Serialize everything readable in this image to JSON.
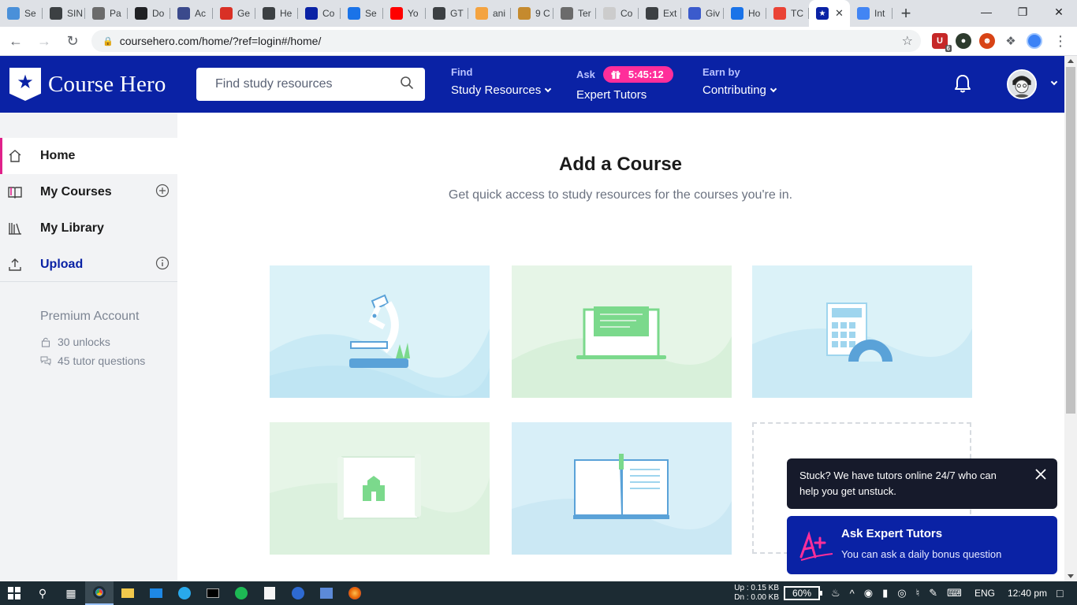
{
  "browser": {
    "tabs": [
      {
        "label": "Se",
        "color": "#4a90d9"
      },
      {
        "label": "SIN",
        "color": "#3c4043"
      },
      {
        "label": "Pa",
        "color": "#6b6b6b"
      },
      {
        "label": "Do",
        "color": "#202124"
      },
      {
        "label": "Ac",
        "color": "#3b4a8c"
      },
      {
        "label": "Ge",
        "color": "#d93025"
      },
      {
        "label": "He",
        "color": "#3c4043"
      },
      {
        "label": "Co",
        "color": "#0a22a5"
      },
      {
        "label": "Se",
        "color": "#1a73e8"
      },
      {
        "label": "Yo",
        "color": "#ff0000"
      },
      {
        "label": "GT",
        "color": "#3c4043"
      },
      {
        "label": "ani",
        "color": "#f4a340"
      },
      {
        "label": "9 C",
        "color": "#c58a2e"
      },
      {
        "label": "Ter",
        "color": "#6b6b6b"
      },
      {
        "label": "Co",
        "color": "#cccccc"
      },
      {
        "label": "Ext",
        "color": "#3c4043"
      },
      {
        "label": "Giv",
        "color": "#3b5bcc"
      },
      {
        "label": "Ho",
        "color": "#1a73e8"
      },
      {
        "label": "TC",
        "color": "#ea4335"
      },
      {
        "label": "",
        "color": "#0a22a5"
      },
      {
        "label": "Int",
        "color": "#4285f4"
      }
    ],
    "active_tab_index": 19,
    "url": "coursehero.com/home/?ref=login#/home/",
    "extension_badge": "6"
  },
  "header": {
    "logo_text": "Course Hero",
    "search_placeholder": "Find study resources",
    "nav": [
      {
        "small": "Find",
        "big": "Study Resources",
        "has_caret": true
      },
      {
        "small": "Ask",
        "big": "Expert Tutors",
        "timer": "5:45:12"
      },
      {
        "small": "Earn by",
        "big": "Contributing",
        "has_caret": true
      }
    ]
  },
  "sidebar": {
    "items": [
      {
        "label": "Home",
        "icon": "home-icon"
      },
      {
        "label": "My Courses",
        "icon": "book-icon",
        "action_icon": "add-circle-icon"
      },
      {
        "label": "My Library",
        "icon": "library-icon"
      },
      {
        "label": "Upload",
        "icon": "upload-icon",
        "action_icon": "info-circle-icon"
      }
    ],
    "premium_title": "Premium Account",
    "unlocks": "30 unlocks",
    "tutor_questions": "45 tutor questions"
  },
  "main": {
    "title": "Add a Course",
    "subtitle": "Get quick access to study resources for the courses you're in.",
    "cards": [
      {
        "subject": "science",
        "icon": "microscope-illustration"
      },
      {
        "subject": "computer",
        "icon": "laptop-illustration"
      },
      {
        "subject": "math",
        "icon": "calculator-illustration"
      },
      {
        "subject": "history",
        "icon": "map-illustration"
      },
      {
        "subject": "literature",
        "icon": "open-book-illustration"
      }
    ]
  },
  "popups": {
    "toast_text": "Stuck? We have tutors online 24/7 who can help you get unstuck.",
    "ask_title": "Ask Expert Tutors",
    "ask_subtitle": "You can ask a daily bonus question"
  },
  "taskbar": {
    "net_up": "Up : 0.15 KB",
    "net_down": "Dn : 0.00 KB",
    "battery": "60%",
    "language": "ENG",
    "time": "12:40 pm"
  },
  "colors": {
    "brand_blue": "#0a22a5",
    "accent_pink": "#ff2e9a",
    "sidebar_bg": "#f2f3f5"
  }
}
